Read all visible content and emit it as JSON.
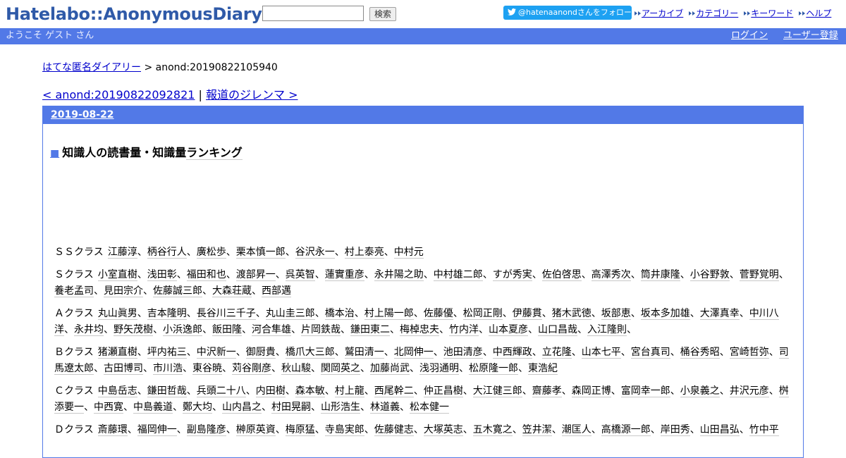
{
  "header": {
    "logo": "Hatelabo::AnonymousDiary",
    "search_placeholder": "",
    "search_button": "検索",
    "follow_button": "@hatenaanondさんをフォロー",
    "nav": [
      "アーカイブ",
      "カテゴリー",
      "キーワード",
      "ヘルプ"
    ]
  },
  "userbar": {
    "welcome": "ようこそ ゲスト さん",
    "login": "ログイン",
    "register": "ユーザー登録"
  },
  "breadcrumb": {
    "home": "はてな匿名ダイアリー",
    "separator": " > ",
    "current": "anond:20190822105940"
  },
  "prevnext": {
    "prev": "< anond:20190822092821",
    "separator": " | ",
    "next": "報道のジレンマ >"
  },
  "day": {
    "date": "2019-08-22",
    "entry_mark": "■",
    "entry_title_main": "知識人の読書量・知識量",
    "entry_title_link": "ランキング"
  },
  "ranks": [
    {
      "label": "ＳＳクラス",
      "names": [
        "江藤淳",
        "柄谷行人",
        "廣松歩",
        "栗本慎一郎",
        "谷沢永一",
        "村上泰亮",
        "中村元"
      ]
    },
    {
      "label": "Ｓクラス",
      "names": [
        "小室直樹",
        "浅田彰",
        "福田和也",
        "渡部昇一",
        "呉英智",
        "蓮實重彦",
        "永井陽之助",
        "中村雄二郎",
        "すが秀実",
        "佐伯啓思",
        "高澤秀次",
        "筒井康隆",
        "小谷野敦",
        "菅野覚明",
        "養老孟司",
        "見田宗介",
        "佐藤誠三郎",
        "大森荘蔵",
        "西部邁"
      ]
    },
    {
      "label": "Ａクラス",
      "names": [
        "丸山眞男",
        "吉本隆明",
        "長谷川三千子",
        "丸山圭三郎",
        "橋本治",
        "村上陽一郎",
        "佐藤優",
        "松岡正剛",
        "伊藤貫",
        "猪木武徳",
        "坂部恵",
        "坂本多加雄",
        "大澤真幸",
        "中川八洋",
        "永井均",
        "野矢茂樹",
        "小浜逸郎",
        "飯田隆",
        "河合隼雄",
        "片岡鉄哉",
        "鎌田東二",
        "梅棹忠夫",
        "竹内洋",
        "山本夏彦",
        "山口昌哉",
        "入江隆則",
        ""
      ]
    },
    {
      "label": "Ｂクラス",
      "names": [
        "猪瀬直樹",
        "坪内祐三",
        "中沢新一",
        "御厨貴",
        "橋爪大三郎",
        "鷲田清一",
        "北岡伸一",
        "池田清彦",
        "中西輝政",
        "立花隆",
        "山本七平",
        "宮台真司",
        "桶谷秀昭",
        "宮崎哲弥",
        "司馬遼太郎",
        "古田博司",
        "市川浩",
        "東谷暁",
        "苅谷剛彦",
        "秋山駿",
        "関岡英之",
        "加藤尚武",
        "浅羽通明",
        "松原隆一郎",
        "東浩紀"
      ]
    },
    {
      "label": "Ｃクラス",
      "names": [
        "中島岳志",
        "鎌田哲哉",
        "兵頭二十八",
        "内田樹",
        "森本敏",
        "村上龍",
        "西尾幹二",
        "仲正昌樹",
        "大江健三郎",
        "齋藤孝",
        "森岡正博",
        "富岡幸一郎",
        "小泉義之",
        "井沢元彦",
        "桝添要一",
        "中西寛",
        "中島義道",
        "鄭大均",
        "山内昌之",
        "村田晃嗣",
        "山形浩生",
        "林道義",
        "松本健一"
      ]
    },
    {
      "label": "Ｄクラス",
      "names": [
        "斎藤環",
        "福岡伸一",
        "副島隆彦",
        "榊原英資",
        "梅原猛",
        "寺島実郎",
        "佐藤健志",
        "大塚英志",
        "五木寛之",
        "笠井潔",
        "潮匡人",
        "高橋源一郎",
        "岸田秀",
        "山田昌弘",
        "竹中平"
      ]
    }
  ]
}
